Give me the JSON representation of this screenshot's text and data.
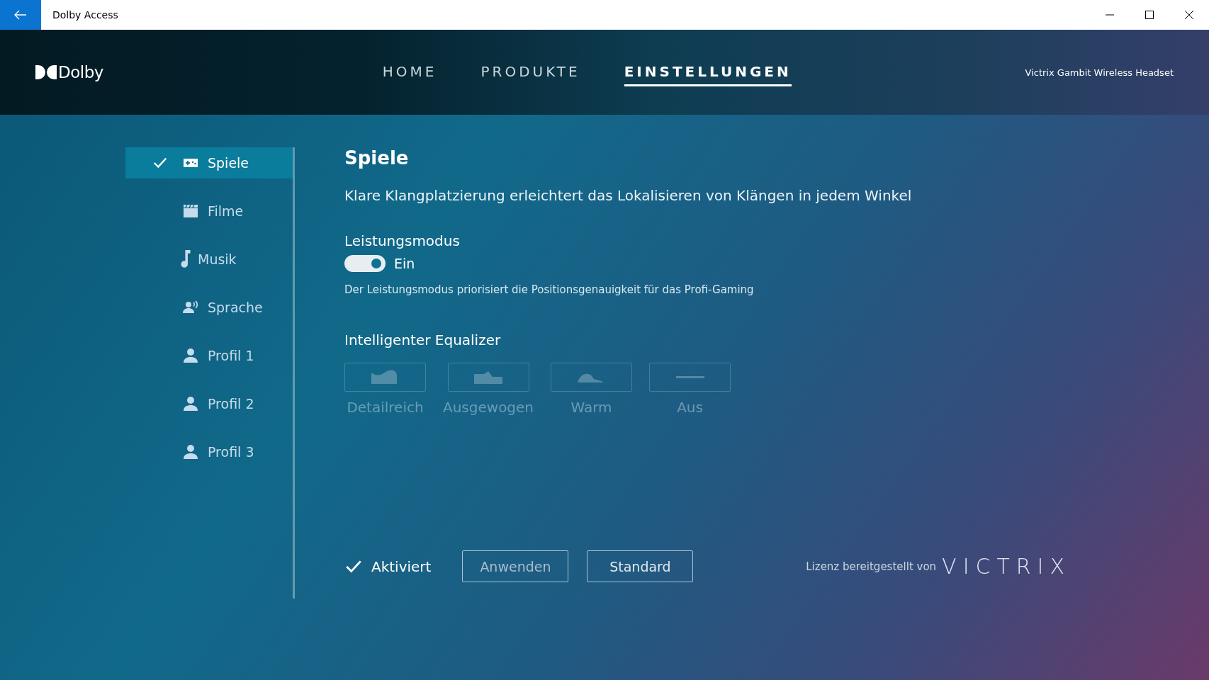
{
  "window": {
    "title": "Dolby Access"
  },
  "header": {
    "logo": "Dolby",
    "nav": [
      {
        "label": "HOME",
        "selected": false
      },
      {
        "label": "PRODUKTE",
        "selected": false
      },
      {
        "label": "EINSTELLUNGEN",
        "selected": true
      }
    ],
    "device": "Victrix Gambit Wireless Headset"
  },
  "sidebar": {
    "items": [
      {
        "label": "Spiele",
        "selected": true
      },
      {
        "label": "Filme",
        "selected": false
      },
      {
        "label": "Musik",
        "selected": false
      },
      {
        "label": "Sprache",
        "selected": false
      },
      {
        "label": "Profil 1",
        "selected": false
      },
      {
        "label": "Profil 2",
        "selected": false
      },
      {
        "label": "Profil 3",
        "selected": false
      }
    ]
  },
  "content": {
    "title": "Spiele",
    "subtitle": "Klare Klangplatzierung erleichtert das Lokalisieren von Klängen in jedem Winkel",
    "performance": {
      "label": "Leistungsmodus",
      "on": true,
      "state": "Ein",
      "description": "Der Leistungsmodus priorisiert die Positionsgenauigkeit für das Profi-Gaming"
    },
    "equalizer": {
      "label": "Intelligenter Equalizer",
      "disabled": true,
      "presets": [
        {
          "label": "Detailreich",
          "selected": false
        },
        {
          "label": "Ausgewogen",
          "selected": false
        },
        {
          "label": "Warm",
          "selected": false
        },
        {
          "label": "Aus",
          "selected": false
        }
      ]
    },
    "activated": {
      "label": "Aktiviert",
      "checked": true
    },
    "buttons": [
      {
        "label": "Anwenden",
        "disabled": true
      },
      {
        "label": "Standard",
        "disabled": false
      }
    ],
    "license": {
      "text": "Lizenz bereitgestellt von",
      "brand": "VICTRIX"
    }
  }
}
